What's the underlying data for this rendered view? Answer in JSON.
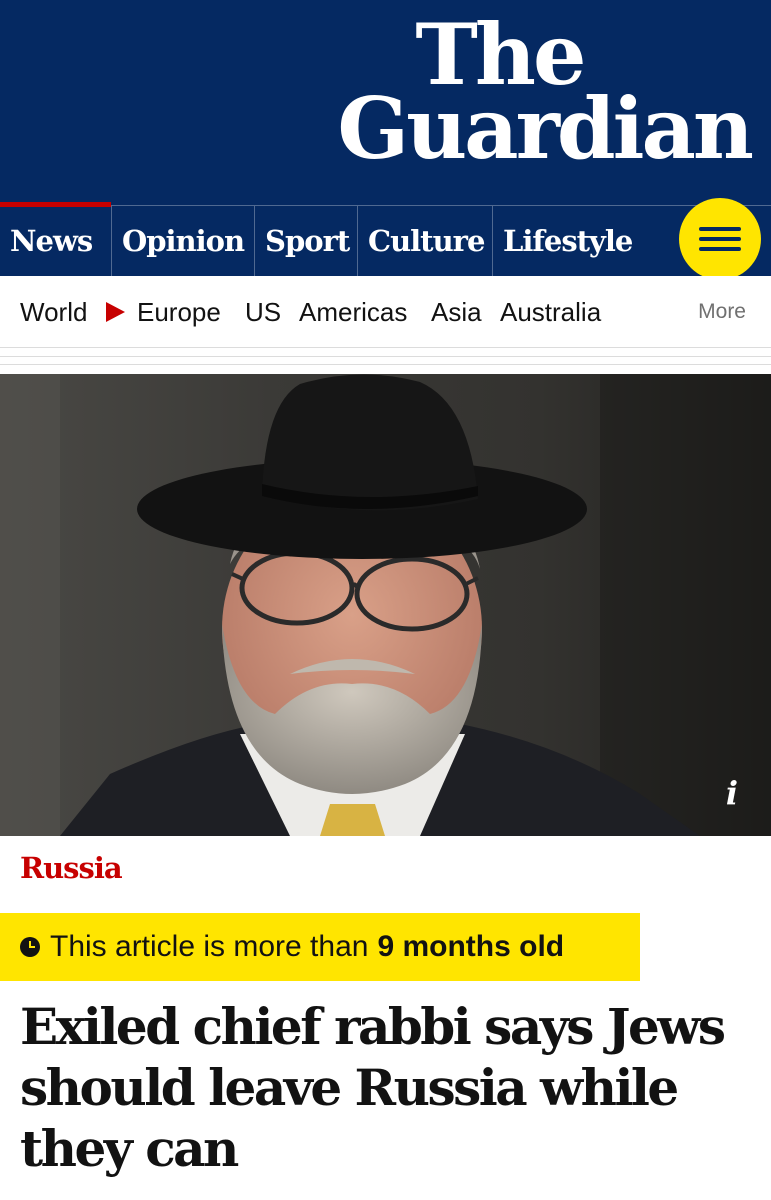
{
  "brand": {
    "logo_line1": "The",
    "logo_line2": "Guardian",
    "background": "#052962",
    "accent_red": "#c70000",
    "highlight_yellow": "#ffe500"
  },
  "pillars": [
    {
      "label": "News",
      "active": true
    },
    {
      "label": "Opinion",
      "active": false
    },
    {
      "label": "Sport",
      "active": false
    },
    {
      "label": "Culture",
      "active": false
    },
    {
      "label": "Lifestyle",
      "active": false
    }
  ],
  "menu_button": {
    "icon": "hamburger-menu-icon"
  },
  "subnav": {
    "items": [
      "World",
      "Europe",
      "US",
      "Americas",
      "Asia",
      "Australia"
    ],
    "current_indicator_icon": "triangle-right-icon",
    "more_label": "More"
  },
  "hero": {
    "info_label": "i",
    "info_icon": "info-icon"
  },
  "article": {
    "kicker": "Russia",
    "age_notice_prefix": "This article is more than",
    "age_notice_value": "9 months old",
    "age_icon": "clock-icon",
    "headline": "Exiled chief rabbi says Jews should leave Russia while they can"
  }
}
